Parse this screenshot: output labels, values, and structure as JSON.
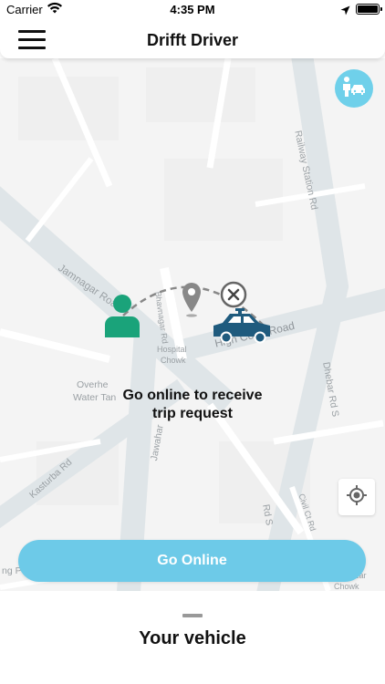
{
  "status_bar": {
    "carrier": "Carrier",
    "time": "4:35 PM",
    "battery_level": 1.0
  },
  "header": {
    "title": "Drifft Driver",
    "menu_icon": "hamburger-menu-icon"
  },
  "map": {
    "road_labels": {
      "railway_station_rd": "Railway Station Rd",
      "jamnagar_road": "Jamnagar Road",
      "bhavnagar_rd": "Bhavnagar Rd",
      "hospital_chowk": "Hospital",
      "hospital_chowk_2": "Chowk",
      "high_court_road": "High Court Road",
      "overhead_water_tank": "Overhe",
      "overhead_water_tank_2": "Water Tan",
      "kasturba_rd": "Kasturba Rd",
      "jawahar_rd": "Jawahar",
      "dhebar_rd": "Dhebar Rd S",
      "civil_ct_rd": "Civil Ct Rd",
      "kar_rd": "Rd S",
      "chowk_bottom": "Chowk",
      "azar": "azar",
      "ng": "ng P"
    },
    "rider_icon": "rider-with-car-icon",
    "locate_icon": "gps-locate-icon",
    "colors": {
      "rider_green": "#1aa37a",
      "pin_grey": "#888888",
      "taxi_blue": "#1f5b7e",
      "accent": "#6dcae8"
    }
  },
  "message": {
    "line1": "Go online to receive",
    "line2": "trip request"
  },
  "go_online": {
    "label": "Go Online"
  },
  "bottom_sheet": {
    "title": "Your vehicle"
  }
}
